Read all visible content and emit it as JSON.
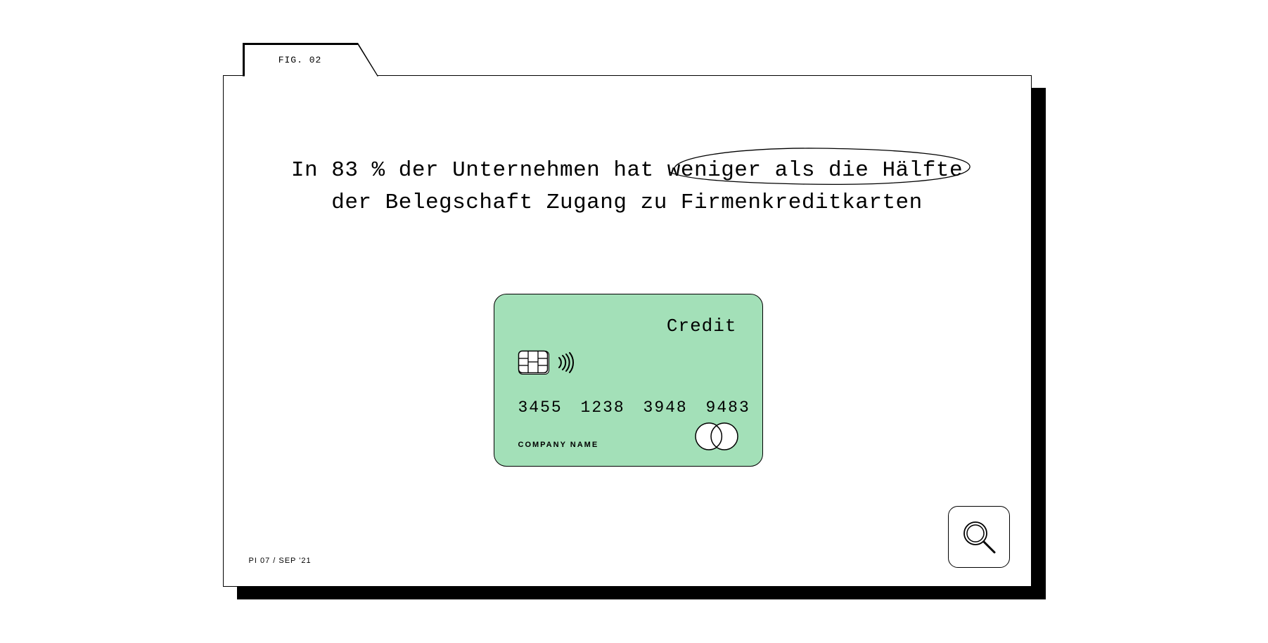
{
  "tab": {
    "label": "FIG. 02"
  },
  "headline": {
    "line1_pre": "In 83 % der Unternehmen hat ",
    "line1_circled": "weniger als die Hälfte",
    "line2": "der Belegschaft Zugang zu Firmenkreditkarten"
  },
  "card": {
    "type_label": "Credit",
    "number": "3455 1238 3948 9483",
    "company": "COMPANY NAME"
  },
  "footer": {
    "label": "PI 07 / SEP '21"
  },
  "colors": {
    "card_bg": "#a3e0b8"
  }
}
